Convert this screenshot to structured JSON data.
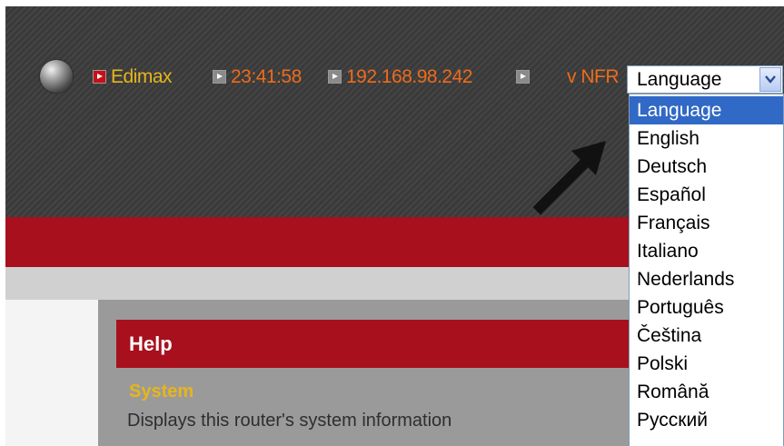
{
  "header": {
    "brand": "Edimax",
    "time": "23:41:58",
    "ip": "192.168.98.242",
    "version": "v NFR",
    "icons": [
      "globe-icon",
      "arrow-marker-icon"
    ]
  },
  "language_select": {
    "selected": "Language",
    "options": [
      "Language",
      "English",
      "Deutsch",
      "Español",
      "Français",
      "Italiano",
      "Nederlands",
      "Português",
      "Čeština",
      "Polski",
      "Română",
      "Русский"
    ],
    "highlighted": "Language"
  },
  "help": {
    "title": "Help",
    "section_title": "System",
    "section_description": "Displays this router's system information"
  },
  "colors": {
    "header_bg": "#3a3a3a",
    "brand_red": "#a8101d",
    "brand_text": "#e6b61c",
    "info_text": "#ec6c1c",
    "highlight": "#3169c6"
  }
}
